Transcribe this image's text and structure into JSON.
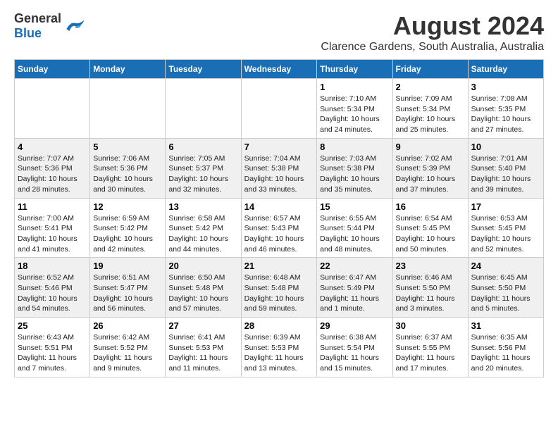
{
  "header": {
    "logo_general": "General",
    "logo_blue": "Blue",
    "title": "August 2024",
    "subtitle": "Clarence Gardens, South Australia, Australia"
  },
  "calendar": {
    "days_of_week": [
      "Sunday",
      "Monday",
      "Tuesday",
      "Wednesday",
      "Thursday",
      "Friday",
      "Saturday"
    ],
    "weeks": [
      [
        {
          "day": "",
          "info": ""
        },
        {
          "day": "",
          "info": ""
        },
        {
          "day": "",
          "info": ""
        },
        {
          "day": "",
          "info": ""
        },
        {
          "day": "1",
          "info": "Sunrise: 7:10 AM\nSunset: 5:34 PM\nDaylight: 10 hours\nand 24 minutes."
        },
        {
          "day": "2",
          "info": "Sunrise: 7:09 AM\nSunset: 5:34 PM\nDaylight: 10 hours\nand 25 minutes."
        },
        {
          "day": "3",
          "info": "Sunrise: 7:08 AM\nSunset: 5:35 PM\nDaylight: 10 hours\nand 27 minutes."
        }
      ],
      [
        {
          "day": "4",
          "info": "Sunrise: 7:07 AM\nSunset: 5:36 PM\nDaylight: 10 hours\nand 28 minutes."
        },
        {
          "day": "5",
          "info": "Sunrise: 7:06 AM\nSunset: 5:36 PM\nDaylight: 10 hours\nand 30 minutes."
        },
        {
          "day": "6",
          "info": "Sunrise: 7:05 AM\nSunset: 5:37 PM\nDaylight: 10 hours\nand 32 minutes."
        },
        {
          "day": "7",
          "info": "Sunrise: 7:04 AM\nSunset: 5:38 PM\nDaylight: 10 hours\nand 33 minutes."
        },
        {
          "day": "8",
          "info": "Sunrise: 7:03 AM\nSunset: 5:38 PM\nDaylight: 10 hours\nand 35 minutes."
        },
        {
          "day": "9",
          "info": "Sunrise: 7:02 AM\nSunset: 5:39 PM\nDaylight: 10 hours\nand 37 minutes."
        },
        {
          "day": "10",
          "info": "Sunrise: 7:01 AM\nSunset: 5:40 PM\nDaylight: 10 hours\nand 39 minutes."
        }
      ],
      [
        {
          "day": "11",
          "info": "Sunrise: 7:00 AM\nSunset: 5:41 PM\nDaylight: 10 hours\nand 41 minutes."
        },
        {
          "day": "12",
          "info": "Sunrise: 6:59 AM\nSunset: 5:42 PM\nDaylight: 10 hours\nand 42 minutes."
        },
        {
          "day": "13",
          "info": "Sunrise: 6:58 AM\nSunset: 5:42 PM\nDaylight: 10 hours\nand 44 minutes."
        },
        {
          "day": "14",
          "info": "Sunrise: 6:57 AM\nSunset: 5:43 PM\nDaylight: 10 hours\nand 46 minutes."
        },
        {
          "day": "15",
          "info": "Sunrise: 6:55 AM\nSunset: 5:44 PM\nDaylight: 10 hours\nand 48 minutes."
        },
        {
          "day": "16",
          "info": "Sunrise: 6:54 AM\nSunset: 5:45 PM\nDaylight: 10 hours\nand 50 minutes."
        },
        {
          "day": "17",
          "info": "Sunrise: 6:53 AM\nSunset: 5:45 PM\nDaylight: 10 hours\nand 52 minutes."
        }
      ],
      [
        {
          "day": "18",
          "info": "Sunrise: 6:52 AM\nSunset: 5:46 PM\nDaylight: 10 hours\nand 54 minutes."
        },
        {
          "day": "19",
          "info": "Sunrise: 6:51 AM\nSunset: 5:47 PM\nDaylight: 10 hours\nand 56 minutes."
        },
        {
          "day": "20",
          "info": "Sunrise: 6:50 AM\nSunset: 5:48 PM\nDaylight: 10 hours\nand 57 minutes."
        },
        {
          "day": "21",
          "info": "Sunrise: 6:48 AM\nSunset: 5:48 PM\nDaylight: 10 hours\nand 59 minutes."
        },
        {
          "day": "22",
          "info": "Sunrise: 6:47 AM\nSunset: 5:49 PM\nDaylight: 11 hours\nand 1 minute."
        },
        {
          "day": "23",
          "info": "Sunrise: 6:46 AM\nSunset: 5:50 PM\nDaylight: 11 hours\nand 3 minutes."
        },
        {
          "day": "24",
          "info": "Sunrise: 6:45 AM\nSunset: 5:50 PM\nDaylight: 11 hours\nand 5 minutes."
        }
      ],
      [
        {
          "day": "25",
          "info": "Sunrise: 6:43 AM\nSunset: 5:51 PM\nDaylight: 11 hours\nand 7 minutes."
        },
        {
          "day": "26",
          "info": "Sunrise: 6:42 AM\nSunset: 5:52 PM\nDaylight: 11 hours\nand 9 minutes."
        },
        {
          "day": "27",
          "info": "Sunrise: 6:41 AM\nSunset: 5:53 PM\nDaylight: 11 hours\nand 11 minutes."
        },
        {
          "day": "28",
          "info": "Sunrise: 6:39 AM\nSunset: 5:53 PM\nDaylight: 11 hours\nand 13 minutes."
        },
        {
          "day": "29",
          "info": "Sunrise: 6:38 AM\nSunset: 5:54 PM\nDaylight: 11 hours\nand 15 minutes."
        },
        {
          "day": "30",
          "info": "Sunrise: 6:37 AM\nSunset: 5:55 PM\nDaylight: 11 hours\nand 17 minutes."
        },
        {
          "day": "31",
          "info": "Sunrise: 6:35 AM\nSunset: 5:56 PM\nDaylight: 11 hours\nand 20 minutes."
        }
      ]
    ]
  }
}
